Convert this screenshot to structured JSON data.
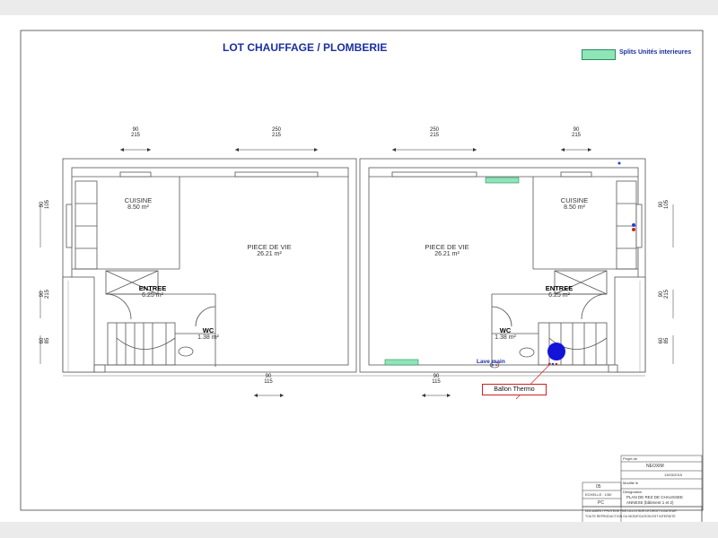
{
  "plan": {
    "title": "LOT CHAUFFAGE / PLOMBERIE",
    "legend": {
      "label": "Splits Unités interieures",
      "color": "#8ee6b8"
    },
    "rooms_left": [
      {
        "name": "CUISINE",
        "area": "8.50 m²"
      },
      {
        "name": "PIECE DE VIE",
        "area": "26.21 m²"
      },
      {
        "name": "ENTREE",
        "area": "6.25 m²"
      },
      {
        "name": "WC",
        "area": "1.38 m²"
      }
    ],
    "rooms_right": [
      {
        "name": "PIECE DE VIE",
        "area": "26.21 m²"
      },
      {
        "name": "CUISINE",
        "area": "8.50 m²"
      },
      {
        "name": "ENTREE",
        "area": "6.25 m²"
      },
      {
        "name": "WC",
        "area": "1.38 m²"
      }
    ],
    "dims_top": [
      {
        "a": "90",
        "b": "215"
      },
      {
        "a": "250",
        "b": "215"
      },
      {
        "a": "250",
        "b": "215"
      },
      {
        "a": "90",
        "b": "215"
      }
    ],
    "dims_bottom": [
      {
        "a": "90",
        "b": "115"
      },
      {
        "a": "90",
        "b": "115"
      }
    ],
    "dims_side": [
      {
        "a": "90",
        "b": "105"
      },
      {
        "a": "90",
        "b": "215"
      },
      {
        "a": "60",
        "b": "85"
      }
    ],
    "lave_main": "Lave main",
    "ballon": "Ballon Thermo",
    "ballon_color": "#1414d8"
  },
  "cartouche": {
    "projet_label": "Projet de",
    "client": "NEOXIM",
    "date": "13/03/2015",
    "modifie_label": "Modifié le",
    "num": "05",
    "designation_label": "Désignation",
    "designation_1": "PLAN DE REZ DE CHAUSSEE",
    "designation_2": "ANNEXE (bâtiment 1 et 2)",
    "echelle": "ECHELLE : 1/50",
    "code": "PC",
    "note_1": "DOCUMENT PROTEGE PAR LA LOI SUR LE DROIT D'AUTEUR",
    "note_2": "TOUTE REPRODUCTION OU MODIFICATION EST INTERDITE"
  }
}
